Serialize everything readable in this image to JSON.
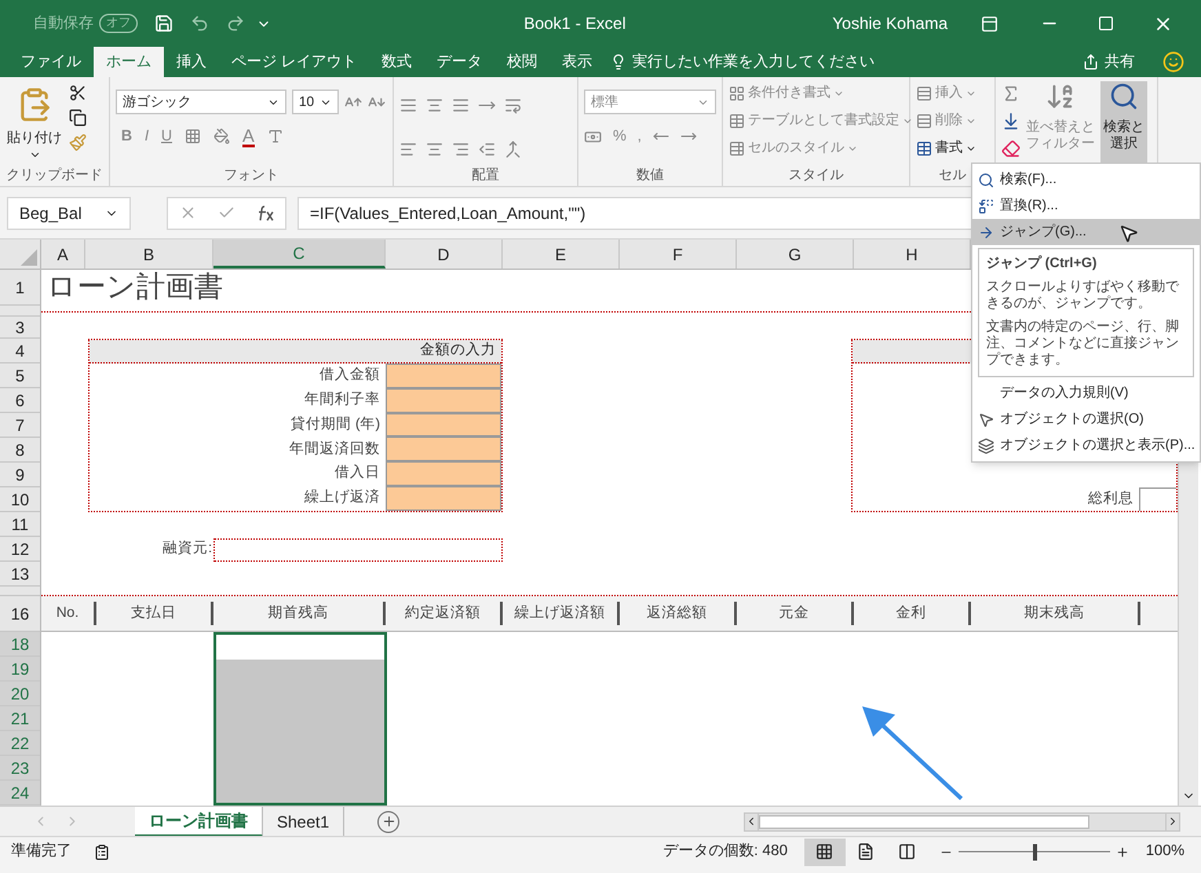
{
  "title_bar": {
    "autosave_label": "自動保存",
    "autosave_state": "オフ",
    "autosave_on": false,
    "title": "Book1 - Excel",
    "user": "Yoshie Kohama"
  },
  "ribbon_tabs": [
    {
      "label": "ファイル",
      "selected": false
    },
    {
      "label": "ホーム",
      "selected": true
    },
    {
      "label": "挿入",
      "selected": false
    },
    {
      "label": "ページ レイアウト",
      "selected": false
    },
    {
      "label": "数式",
      "selected": false
    },
    {
      "label": "データ",
      "selected": false
    },
    {
      "label": "校閲",
      "selected": false
    },
    {
      "label": "表示",
      "selected": false
    }
  ],
  "tell_me": "実行したい作業を入力してください",
  "share": "共有",
  "ribbon": {
    "clipboard": {
      "paste": "貼り付け",
      "label": "クリップボード"
    },
    "font": {
      "name": "游ゴシック",
      "size": "10",
      "bold": "B",
      "italic": "I",
      "underline": "U",
      "font_color": "A",
      "label": "フォント"
    },
    "alignment": {
      "label": "配置"
    },
    "number": {
      "format": "標準",
      "percent": "%",
      "comma": ",",
      "label": "数値"
    },
    "styles": {
      "items": [
        "条件付き書式",
        "テーブルとして書式設定",
        "セルのスタイル"
      ],
      "label": "スタイル"
    },
    "cells": {
      "items": [
        "挿入",
        "削除",
        "書式"
      ],
      "label": "セル"
    },
    "editing": {
      "sort": [
        "並べ替えと",
        "フィルター"
      ],
      "find": [
        "検索と",
        "選択"
      ],
      "find_open": true
    }
  },
  "formula_bar": {
    "name_box": "Beg_Bal",
    "formula": "=IF(Values_Entered,Loan_Amount,\"\")"
  },
  "columns": [
    {
      "label": "A",
      "selected": false
    },
    {
      "label": "B",
      "selected": false
    },
    {
      "label": "C",
      "selected": true
    },
    {
      "label": "D",
      "selected": false
    },
    {
      "label": "E",
      "selected": false
    },
    {
      "label": "F",
      "selected": false
    },
    {
      "label": "G",
      "selected": false
    },
    {
      "label": "H",
      "selected": false
    }
  ],
  "rows": [
    {
      "label": "1",
      "selected": false
    },
    {
      "label": "3",
      "selected": false
    },
    {
      "label": "4",
      "selected": false
    },
    {
      "label": "5",
      "selected": false
    },
    {
      "label": "6",
      "selected": false
    },
    {
      "label": "7",
      "selected": false
    },
    {
      "label": "8",
      "selected": false
    },
    {
      "label": "9",
      "selected": false
    },
    {
      "label": "10",
      "selected": false
    },
    {
      "label": "11",
      "selected": false
    },
    {
      "label": "12",
      "selected": false
    },
    {
      "label": "13",
      "selected": false
    },
    {
      "label": "16",
      "selected": false
    },
    {
      "label": "18",
      "selected": true
    },
    {
      "label": "19",
      "selected": true
    },
    {
      "label": "20",
      "selected": true
    },
    {
      "label": "21",
      "selected": true
    },
    {
      "label": "22",
      "selected": true
    },
    {
      "label": "23",
      "selected": true
    },
    {
      "label": "24",
      "selected": true
    }
  ],
  "sheet": {
    "title": "ローン計画書",
    "input_box": {
      "header": "金額の入力",
      "fields": [
        "借入金額",
        "年間利子率",
        "貸付期間 (年)",
        "年間返済回数",
        "借入日",
        "繰上げ返済"
      ]
    },
    "summary_box": {
      "label": "総利息"
    },
    "lender_label": "融資元:",
    "schedule_headers": [
      "No.",
      "支払日",
      "期首残高",
      "約定返済額",
      "繰上げ返済額",
      "返済総額",
      "元金",
      "金利",
      "期末残高"
    ]
  },
  "menu": {
    "items": [
      {
        "kind": "item",
        "label": "検索(F)...",
        "selected": false
      },
      {
        "kind": "item",
        "label": "置換(R)...",
        "selected": false
      },
      {
        "kind": "item",
        "label": "ジャンプ(G)...",
        "selected": true
      },
      {
        "kind": "tooltip",
        "title": "ジャンプ (Ctrl+G)",
        "lines": [
          "スクロールよりすばやく移動できるのが、ジャンプです。",
          "文書内の特定のページ、行、脚注、コメントなどに直接ジャンプできます。"
        ]
      },
      {
        "kind": "item",
        "label": "データの入力規則(V)",
        "selected": false
      },
      {
        "kind": "item",
        "label": "オブジェクトの選択(O)",
        "selected": false
      },
      {
        "kind": "item",
        "label": "オブジェクトの選択と表示(P)...",
        "selected": false
      }
    ]
  },
  "sheet_tabs": [
    {
      "label": "ローン計画書",
      "selected": true
    },
    {
      "label": "Sheet1",
      "selected": false
    }
  ],
  "status_bar": {
    "ready": "準備完了",
    "count": "データの個数: 480",
    "views": [
      {
        "selected": true
      },
      {
        "selected": false
      },
      {
        "selected": false
      }
    ],
    "zoom": {
      "level": 0.5
    },
    "zoom_text": "100%"
  }
}
